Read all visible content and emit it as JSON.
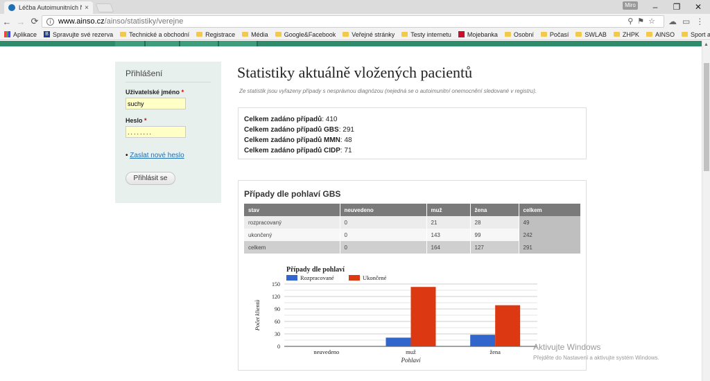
{
  "browser": {
    "tab_title": "Léčba Autoimunitních N",
    "tab_close": "×",
    "user_badge": "Miro",
    "url_host": "www.ainso.cz",
    "url_path": "/ainso/statistiky/verejne",
    "bookmarks": [
      "Aplikace",
      "Spravujte své rezerva",
      "Technické a obchodní",
      "Registrace",
      "Média",
      "Google&Facebook",
      "Veřejné stránky",
      "Testy internetu",
      "Mojebanka",
      "Osobní",
      "Počasí",
      "SWLAB",
      "ZHPK",
      "AINSO",
      "Sport a turistika"
    ]
  },
  "login": {
    "title": "Přihlášení",
    "username_label": "Uživatelské jméno",
    "username_value": "suchy",
    "password_label": "Heslo",
    "password_value": "........",
    "required_mark": "*",
    "reset_link": "Zaslat nové heslo",
    "submit_label": "Přihlásit se"
  },
  "main": {
    "title": "Statistiky aktuálně vložených pacientů",
    "subtitle": "Ze statistik jsou vyřazeny případy s nesprávnou diagnózou (nejedná se o autoimunitní onemocnění sledované v registru).",
    "summary": [
      {
        "label": "Celkem zadáno případů",
        "value": ": 410"
      },
      {
        "label": "Celkem zadáno případů GBS",
        "value": ": 291"
      },
      {
        "label": "Celkem zadáno případů MMN",
        "value": ": 48"
      },
      {
        "label": "Celkem zadáno případů CIDP",
        "value": ": 71"
      }
    ],
    "gbs_title": "Případy dle pohlaví GBS",
    "table": {
      "headers": [
        "stav",
        "neuvedeno",
        "muž",
        "žena",
        "celkem"
      ],
      "rows": [
        [
          "rozpracovaný",
          "0",
          "21",
          "28",
          "49"
        ],
        [
          "ukončený",
          "0",
          "143",
          "99",
          "242"
        ],
        [
          "celkem",
          "0",
          "164",
          "127",
          "291"
        ]
      ]
    }
  },
  "chart_data": {
    "type": "bar",
    "title": "Případy dle pohlaví",
    "xlabel": "Pohlaví",
    "ylabel": "Počet klientů",
    "categories": [
      "neuvedeno",
      "muž",
      "žena"
    ],
    "series": [
      {
        "name": "Rozpracované",
        "values": [
          0,
          21,
          28
        ],
        "color": "#3366cc"
      },
      {
        "name": "Ukončené",
        "values": [
          0,
          143,
          99
        ],
        "color": "#dc3912"
      }
    ],
    "ylim": [
      0,
      150
    ],
    "yticks": [
      0,
      30,
      60,
      90,
      120,
      150
    ],
    "legend": "top-left",
    "grid": true
  },
  "os": {
    "watermark_title": "Aktivujte Windows",
    "watermark_text": "Přejděte do Nastavení a aktivujte systém Windows."
  }
}
